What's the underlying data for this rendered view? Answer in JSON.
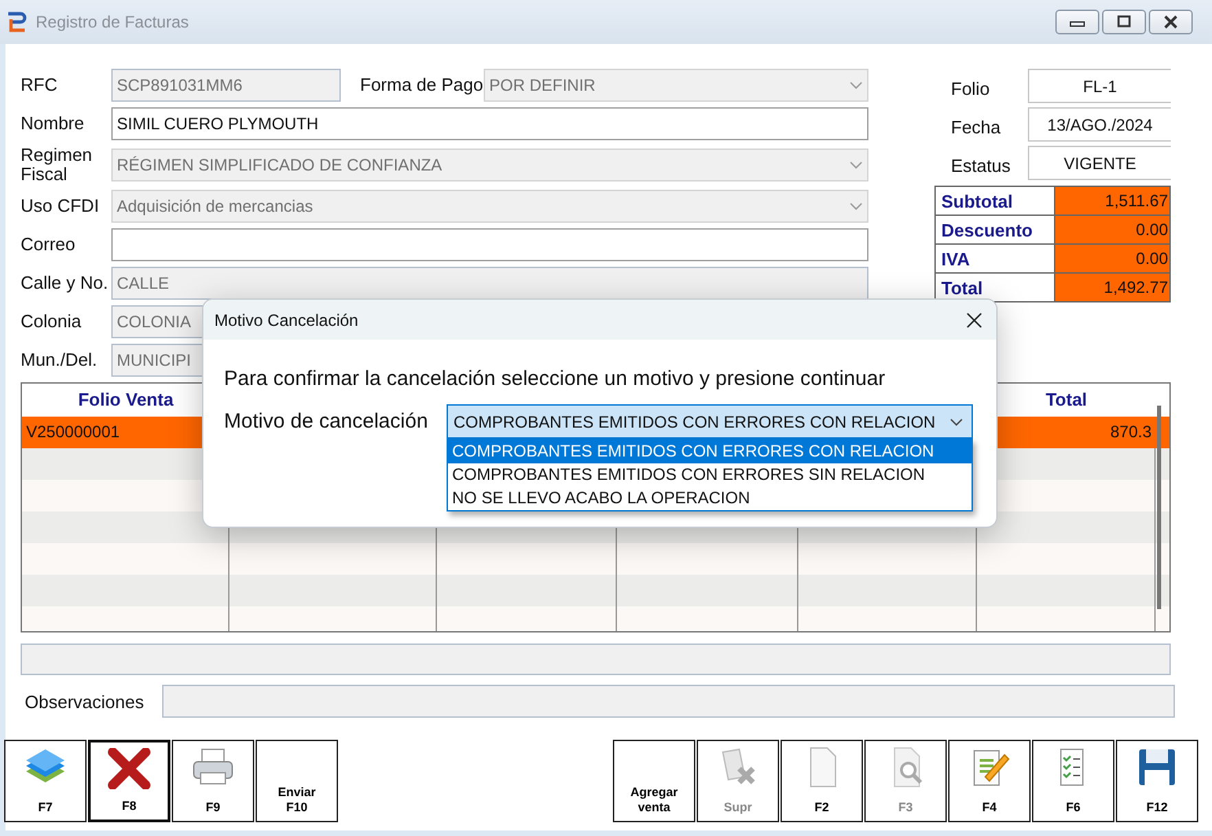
{
  "window": {
    "title": "Registro de Facturas"
  },
  "form": {
    "rows": [
      [
        {
          "label": "RFC",
          "kind": "text",
          "value": "SCP891031MM6",
          "disabled": true
        },
        {
          "label": "Forma de Pago",
          "kind": "select",
          "value": "POR DEFINIR",
          "disabled": true
        }
      ],
      [
        {
          "label": "Nombre",
          "kind": "text",
          "value": "SIMIL CUERO PLYMOUTH",
          "disabled": false
        }
      ],
      [
        {
          "label": "Regimen Fiscal",
          "kind": "select",
          "value": "RÉGIMEN SIMPLIFICADO DE CONFIANZA",
          "disabled": true
        }
      ],
      [
        {
          "label": "Uso CFDI",
          "kind": "select",
          "value": "Adquisición de mercancias",
          "disabled": true
        }
      ],
      [
        {
          "label": "Correo",
          "kind": "text",
          "disabled": false
        }
      ],
      [
        {
          "label": "Calle y No.",
          "kind": "text",
          "value": "CALLE",
          "disabled": true
        }
      ],
      [
        {
          "label": "Colonia",
          "kind": "text",
          "value": "COLONIA",
          "disabled": true
        }
      ],
      [
        {
          "label": "Mun./Del.",
          "kind": "text",
          "value": "MUNICIPI",
          "disabled": true
        }
      ]
    ]
  },
  "info": [
    {
      "label": "Folio",
      "value": "FL-1"
    },
    {
      "label": "Fecha",
      "value": "13/AGO./2024"
    },
    {
      "label": "Estatus",
      "value": "VIGENTE"
    }
  ],
  "totals": [
    {
      "label": "Subtotal",
      "value": "1,511.67"
    },
    {
      "label": "Descuento",
      "value": "0.00"
    },
    {
      "label": "IVA",
      "value": "0.00"
    },
    {
      "label": "Total",
      "value": "1,492.77"
    }
  ],
  "table": {
    "columns": [
      "Folio Venta",
      "",
      "",
      "",
      "",
      "Total"
    ],
    "rows": [
      {
        "cells": [
          "V250000001",
          "",
          "",
          "",
          "",
          "870.3"
        ],
        "selected": true
      }
    ]
  },
  "observaciones": {
    "label": "Observaciones",
    "disabled": true
  },
  "toolbar": [
    {
      "label": "F7",
      "disabled": false,
      "focused": false
    },
    {
      "label": "F8",
      "disabled": false,
      "focused": true
    },
    {
      "label": "F9",
      "disabled": false,
      "focused": false
    },
    {
      "label": "Enviar\nF10",
      "disabled": false,
      "focused": false
    },
    {
      "label": "Agregar\nventa",
      "disabled": false,
      "focused": false
    },
    {
      "label": "Supr",
      "disabled": true,
      "focused": false
    },
    {
      "label": "F2",
      "disabled": false,
      "focused": false
    },
    {
      "label": "F3",
      "disabled": true,
      "focused": false
    },
    {
      "label": "F4",
      "disabled": false,
      "focused": false
    },
    {
      "label": "F6",
      "disabled": false,
      "focused": false
    },
    {
      "label": "F12",
      "disabled": false,
      "focused": false
    }
  ],
  "dialog": {
    "title": "Motivo Cancelación",
    "message": "Para confirmar la cancelación seleccione un motivo y presione continuar",
    "label": "Motivo de cancelación",
    "value": "COMPROBANTES EMITIDOS CON ERRORES CON RELACION",
    "options": [
      {
        "label": "COMPROBANTES EMITIDOS CON ERRORES CON RELACION",
        "selected": true
      },
      {
        "label": "COMPROBANTES EMITIDOS CON ERRORES SIN RELACION",
        "selected": false
      },
      {
        "label": "NO SE LLEVO ACABO LA OPERACION",
        "selected": false
      }
    ]
  }
}
